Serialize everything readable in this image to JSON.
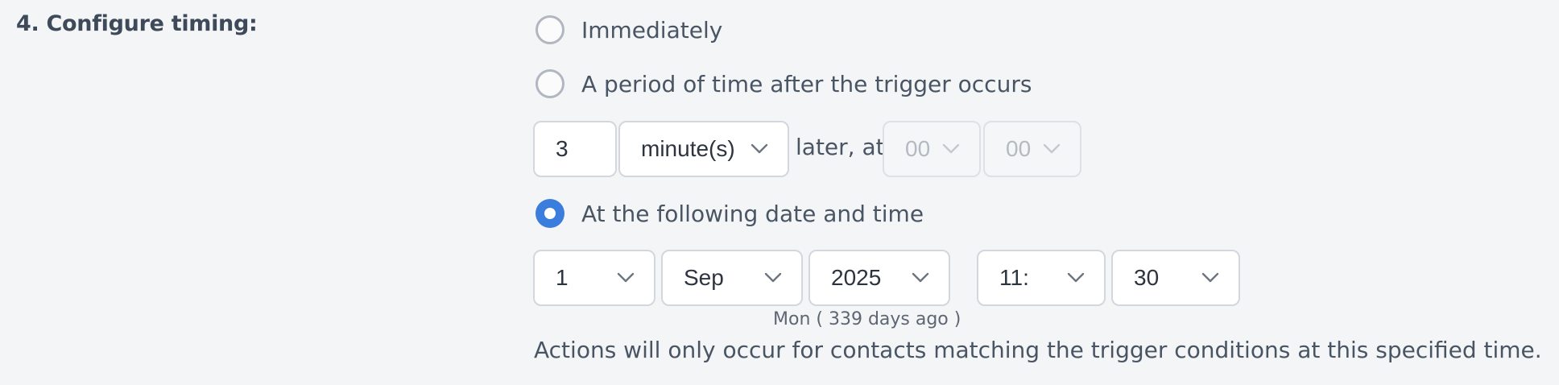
{
  "section": {
    "title": "4. Configure timing:"
  },
  "options": [
    {
      "label": "Immediately",
      "selected": false
    },
    {
      "label": "A period of time after the trigger occurs",
      "selected": false
    },
    {
      "label": "At the following date and time",
      "selected": true
    }
  ],
  "period": {
    "amount": "3",
    "unit": "minute(s)",
    "later_at_label": "later, at",
    "hour": "00",
    "minute": "00"
  },
  "datetime": {
    "day": "1",
    "month": "Sep",
    "year": "2025",
    "hour": "11:",
    "minute": "30",
    "day_note": "Mon ( 339 days ago )"
  },
  "footnote": "Actions will only occur for contacts matching the trigger conditions at this specified time.",
  "colors": {
    "accent": "#3b7ddd",
    "background": "#f4f5f7",
    "text": "#4a5564"
  },
  "icons": {
    "dropdown": "chevron-down-icon"
  }
}
